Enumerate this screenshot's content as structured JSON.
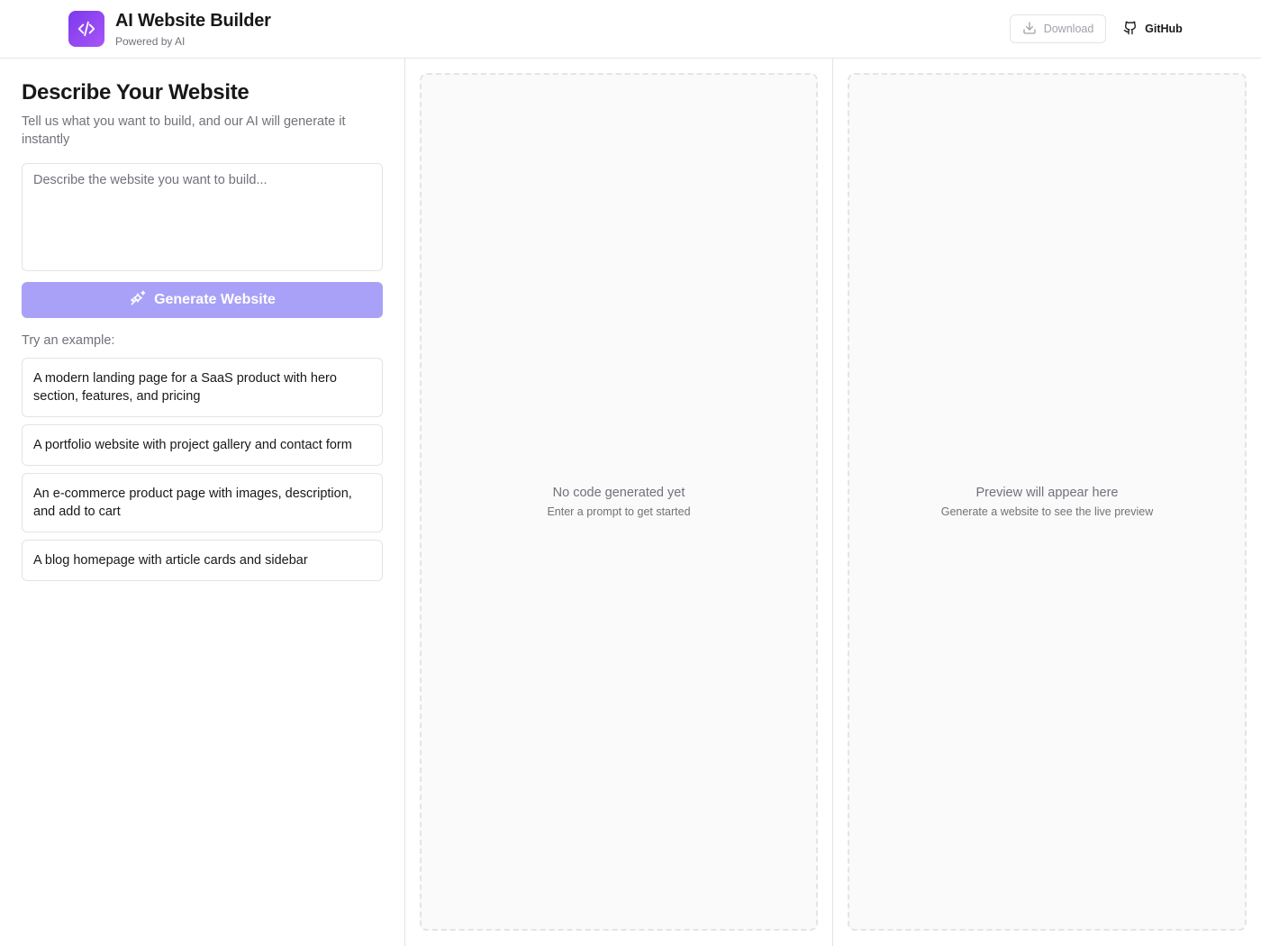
{
  "header": {
    "title": "AI Website Builder",
    "subtitle": "Powered by AI",
    "download_label": "Download",
    "github_label": "GitHub"
  },
  "left": {
    "heading": "Describe Your Website",
    "description": "Tell us what you want to build, and our AI will generate it instantly",
    "prompt_placeholder": "Describe the website you want to build...",
    "generate_label": "Generate Website",
    "try_label": "Try an example:",
    "examples": [
      "A modern landing page for a SaaS product with hero section, features, and pricing",
      "A portfolio website with project gallery and contact form",
      "An e-commerce product page with images, description, and add to cart",
      "A blog homepage with article cards and sidebar"
    ]
  },
  "code_panel": {
    "empty_title": "No code generated yet",
    "empty_sub": "Enter a prompt to get started"
  },
  "preview_panel": {
    "empty_title": "Preview will appear here",
    "empty_sub": "Generate a website to see the live preview"
  },
  "colors": {
    "accent_start": "#7c3aed",
    "accent_end": "#a855f7",
    "generate_button": "#a9a1f8"
  },
  "icons": {
    "logo": "code-icon",
    "download": "download-icon",
    "github": "github-icon",
    "generate": "sparkles-icon"
  }
}
